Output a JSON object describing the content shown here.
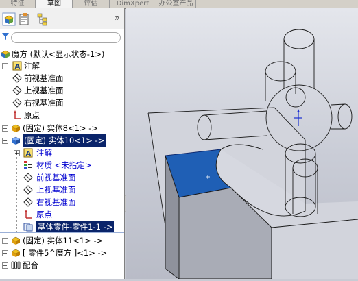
{
  "tabs": [
    {
      "label": "特征",
      "active": false
    },
    {
      "label": "草图",
      "active": true
    },
    {
      "label": "评估",
      "active": false
    },
    {
      "label": "DimXpert",
      "active": false
    },
    {
      "label": "办公室产品",
      "active": false
    }
  ],
  "toolbar": {
    "buttons": [
      "feature-manager-icon",
      "property-manager-icon",
      "configuration-manager-icon"
    ],
    "collapse_label": "»"
  },
  "tree": {
    "items": [
      {
        "label": "魔方 (默认<显示状态-1>)",
        "icon": "assembly-icon",
        "style": "normal"
      },
      {
        "label": "注解",
        "icon": "annotation-icon",
        "style": "normal"
      },
      {
        "label": "前视基准面",
        "icon": "plane-icon",
        "style": "normal"
      },
      {
        "label": "上视基准面",
        "icon": "plane-icon",
        "style": "normal"
      },
      {
        "label": "右视基准面",
        "icon": "plane-icon",
        "style": "normal"
      },
      {
        "label": "原点",
        "icon": "origin-icon",
        "style": "normal"
      },
      {
        "label": "(固定) 实体8<1> ->",
        "icon": "part-icon",
        "style": "normal"
      },
      {
        "label": "(固定) 实体10<1> ->",
        "icon": "part-icon",
        "style": "selected"
      },
      {
        "label": "注解",
        "icon": "annotation-icon",
        "style": "blue"
      },
      {
        "label": "材质 <未指定>",
        "icon": "material-icon",
        "style": "blue"
      },
      {
        "label": "前视基准面",
        "icon": "plane-icon",
        "style": "blue"
      },
      {
        "label": "上视基准面",
        "icon": "plane-icon",
        "style": "blue"
      },
      {
        "label": "右视基准面",
        "icon": "plane-icon",
        "style": "blue"
      },
      {
        "label": "原点",
        "icon": "origin-icon",
        "style": "blue"
      },
      {
        "label": "基体零件-零件1-1 ->",
        "icon": "base-part-icon",
        "style": "selected"
      },
      {
        "label": "(固定) 实体11<1> ->",
        "icon": "part-icon",
        "style": "normal"
      },
      {
        "label": "[ 零件5^魔方 ]<1> ->",
        "icon": "part-icon",
        "style": "normal"
      },
      {
        "label": "配合",
        "icon": "mates-icon",
        "style": "normal"
      }
    ]
  },
  "colors": {
    "selection": "#0a246a",
    "highlight_face": "#1f5fb5",
    "child_text": "#0000d0"
  }
}
